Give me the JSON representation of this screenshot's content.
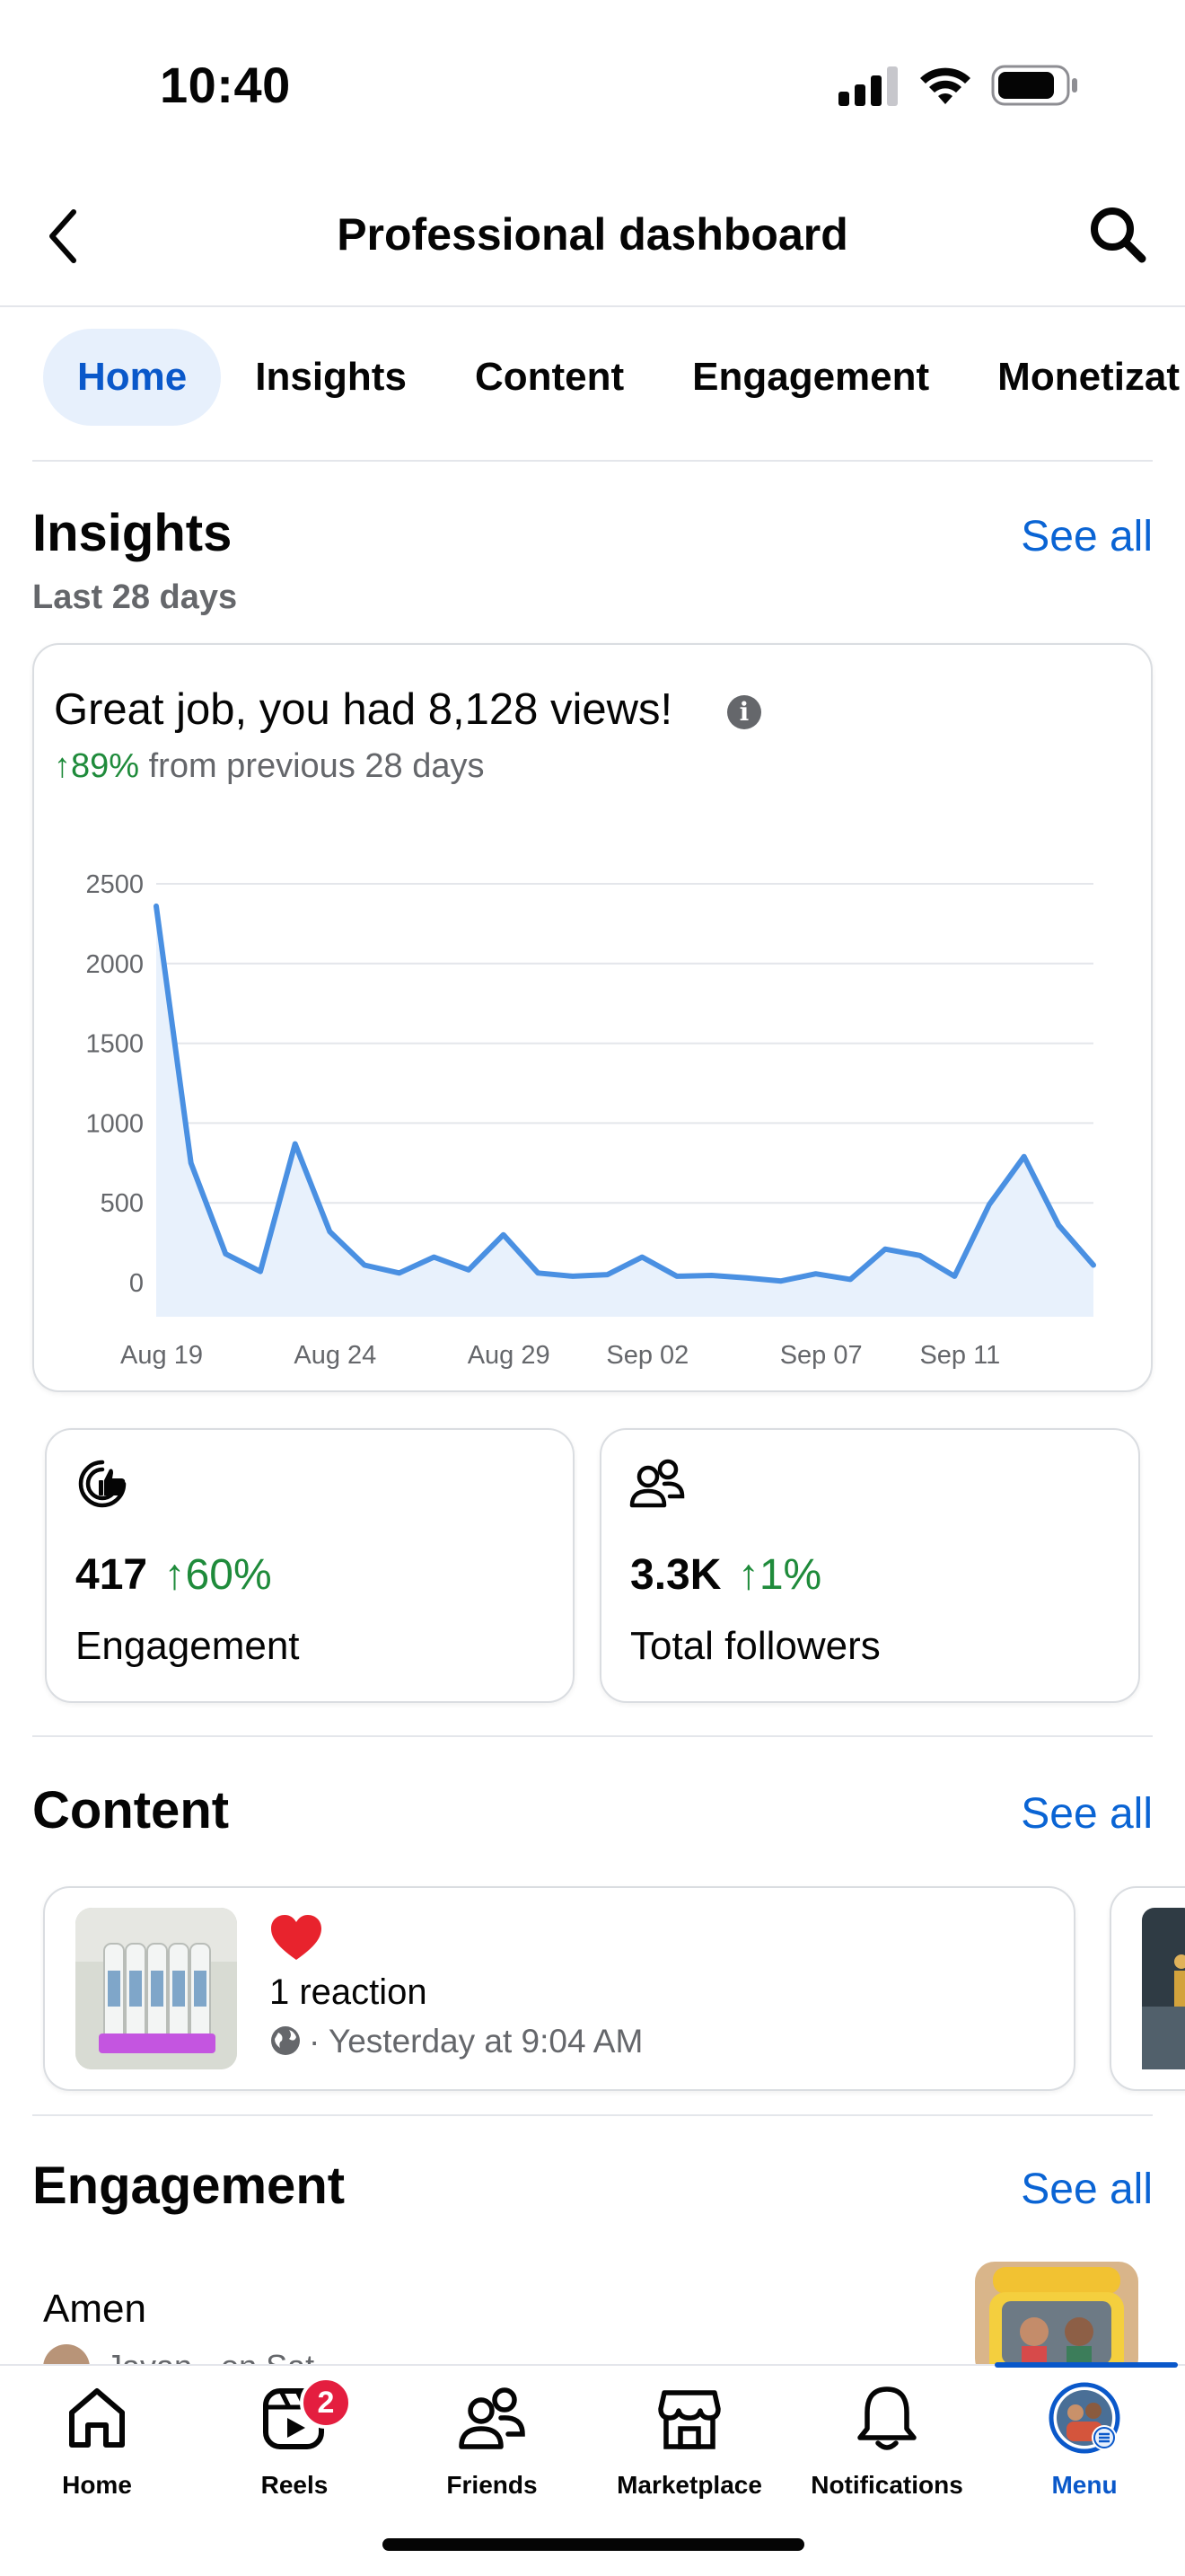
{
  "status_bar": {
    "time": "10:40"
  },
  "header": {
    "title": "Professional dashboard",
    "back_icon": "chevron-left-icon",
    "search_icon": "search-icon"
  },
  "tabs": [
    {
      "label": "Home",
      "active": true
    },
    {
      "label": "Insights"
    },
    {
      "label": "Content"
    },
    {
      "label": "Engagement"
    },
    {
      "label": "Monetizat"
    }
  ],
  "insights": {
    "title": "Insights",
    "see_all": "See all",
    "period": "Last 28 days",
    "headline": "Great job, you had 8,128 views!",
    "growth_arrow": "↑89%",
    "growth_text": "from previous 28 days"
  },
  "chart_data": {
    "type": "area",
    "title": "",
    "xlabel": "",
    "ylabel": "",
    "ylim": [
      0,
      2500
    ],
    "yticks": [
      "2500",
      "2000",
      "1500",
      "1000",
      "500",
      "0"
    ],
    "xticks": [
      "Aug 19",
      "Aug 24",
      "Aug 29",
      "Sep 02",
      "Sep 07",
      "Sep 11"
    ],
    "x": [
      "Aug 19",
      "Aug 20",
      "Aug 21",
      "Aug 22",
      "Aug 23",
      "Aug 24",
      "Aug 25",
      "Aug 26",
      "Aug 27",
      "Aug 28",
      "Aug 29",
      "Aug 30",
      "Aug 31",
      "Sep 01",
      "Sep 02",
      "Sep 03",
      "Sep 04",
      "Sep 05",
      "Sep 06",
      "Sep 07",
      "Sep 08",
      "Sep 09",
      "Sep 10",
      "Sep 11",
      "Sep 12",
      "Sep 13",
      "Sep 14",
      "Sep 15"
    ],
    "series": [
      {
        "values": [
          2360,
          750,
          180,
          70,
          870,
          320,
          110,
          60,
          160,
          80,
          300,
          60,
          40,
          50,
          160,
          40,
          45,
          30,
          10,
          55,
          20,
          210,
          170,
          40,
          490,
          790,
          360,
          110
        ]
      }
    ],
    "grid": true,
    "color": "#4a90e2"
  },
  "stats": [
    {
      "icon": "like-engagement-icon",
      "value": "417",
      "change": "↑60%",
      "label": "Engagement"
    },
    {
      "icon": "followers-icon",
      "value": "3.3K",
      "change": "↑1%",
      "label": "Total followers"
    }
  ],
  "content": {
    "title": "Content",
    "see_all": "See all",
    "post": {
      "reaction_icon": "heart-icon",
      "reactions": "1 reaction",
      "meta": "· Yesterday at 9:04 AM",
      "privacy_icon": "globe-icon"
    }
  },
  "engagement": {
    "title": "Engagement",
    "see_all": "See all",
    "item": {
      "name": "Amen",
      "meta": "Javan · on Sat"
    }
  },
  "nav": [
    {
      "label": "Home",
      "icon": "home-icon"
    },
    {
      "label": "Reels",
      "icon": "reels-icon",
      "badge": "2"
    },
    {
      "label": "Friends",
      "icon": "friends-icon"
    },
    {
      "label": "Marketplace",
      "icon": "marketplace-icon"
    },
    {
      "label": "Notifications",
      "icon": "bell-icon"
    },
    {
      "label": "Menu",
      "icon": "avatar-menu-icon",
      "active": true
    }
  ],
  "colors": {
    "accent": "#0a58ca",
    "link": "#0a64d4",
    "positive": "#1f8b3b",
    "badge": "#e41e3f",
    "chart_line": "#4a90e2"
  }
}
